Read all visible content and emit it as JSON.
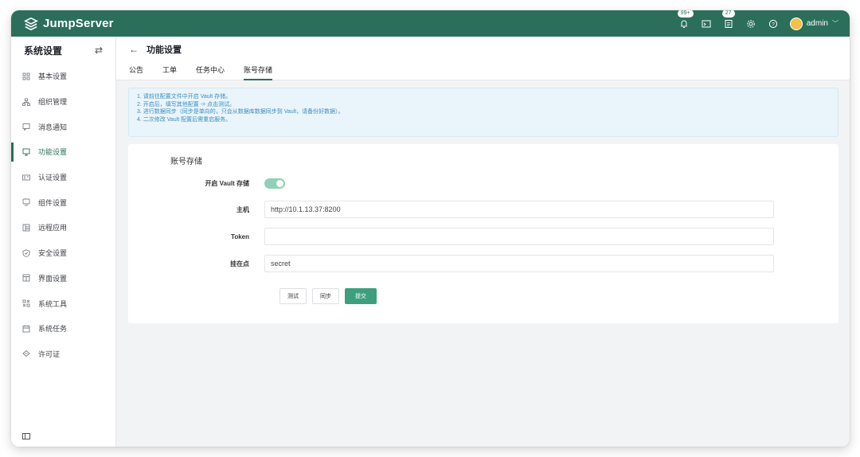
{
  "app": {
    "brand": "JumpServer",
    "notifications_badge": "99+",
    "tickets_badge": "27",
    "user": "admin",
    "brand_color": "#2b6f5a"
  },
  "sidebar": {
    "title": "系统设置",
    "items": [
      {
        "label": "基本设置",
        "icon": "grid-icon"
      },
      {
        "label": "组织管理",
        "icon": "org-icon"
      },
      {
        "label": "消息通知",
        "icon": "message-icon"
      },
      {
        "label": "功能设置",
        "icon": "feature-icon",
        "active": true
      },
      {
        "label": "认证设置",
        "icon": "id-card-icon"
      },
      {
        "label": "组件设置",
        "icon": "monitor-icon"
      },
      {
        "label": "远程应用",
        "icon": "app-icon"
      },
      {
        "label": "安全设置",
        "icon": "shield-icon"
      },
      {
        "label": "界面设置",
        "icon": "layout-icon"
      },
      {
        "label": "系统工具",
        "icon": "tools-icon"
      },
      {
        "label": "系统任务",
        "icon": "task-icon"
      },
      {
        "label": "许可证",
        "icon": "license-icon"
      }
    ]
  },
  "page": {
    "title": "功能设置",
    "tabs": [
      "公告",
      "工单",
      "任务中心",
      "账号存储"
    ],
    "active_tab": "账号存储"
  },
  "notice": [
    "1. 请前往配置文件中开启 Vault 存储。",
    "2. 开启后，填写其他配置 -> 点击测试。",
    "3. 进行数据同步（同步是单向的，只会从数据库数据同步到 Vault，请备份好数据）。",
    "4. 二次修改 Vault 配置后需重启服务。"
  ],
  "form": {
    "section_title": "账号存储",
    "vault_toggle_label": "开启 Vault 存储",
    "vault_enabled": true,
    "host_label": "主机",
    "host_value": "http://10.1.13.37:8200",
    "token_label": "Token",
    "token_value": "",
    "mount_label": "挂在点",
    "mount_value": "secret",
    "test_button": "测试",
    "sync_button": "同步",
    "submit_button": "提交"
  }
}
